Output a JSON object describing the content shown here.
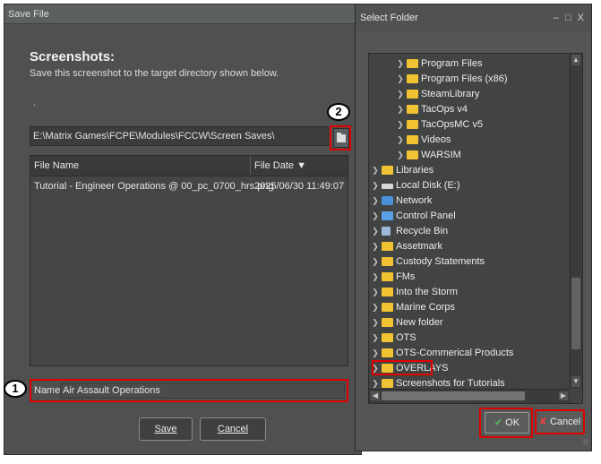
{
  "save_dialog": {
    "title": "Save File",
    "heading": "Screenshots:",
    "subtitle": "Save this screenshot to the target directory shown below.",
    "dot": ".",
    "path": "E:\\Matrix Games\\FCPE\\Modules\\FCCW\\Screen Saves\\",
    "columns": {
      "name": "File Name",
      "date": "File Date ▼"
    },
    "files": [
      {
        "name": "Tutorial - Engineer Operations @ 00_pc_0700_hrs.png",
        "date": "2025/06/30 11:49:07"
      }
    ],
    "name_label": "Name:",
    "name_value": "Air Assault Operations",
    "save_label": "Save",
    "cancel_label": "Cancel"
  },
  "annotations": {
    "badge1": "1",
    "badge2": "2",
    "highlight_color": "#e00000"
  },
  "folder_dialog": {
    "title": "Select Folder",
    "window_controls": "– □ X",
    "tree": [
      {
        "label": "Program Files",
        "icon": "folder-icon"
      },
      {
        "label": "Program Files (x86)",
        "icon": "folder-icon"
      },
      {
        "label": "SteamLibrary",
        "icon": "folder-icon"
      },
      {
        "label": "TacOps v4",
        "icon": "folder-icon"
      },
      {
        "label": "TacOpsMC v5",
        "icon": "folder-icon"
      },
      {
        "label": "Videos",
        "icon": "folder-icon"
      },
      {
        "label": "WARSIM",
        "icon": "folder-icon"
      },
      {
        "label": "Libraries",
        "icon": "folder-icon"
      },
      {
        "label": "Local Disk (E:)",
        "icon": "drive-icon"
      },
      {
        "label": "Network",
        "icon": "network-icon"
      },
      {
        "label": "Control Panel",
        "icon": "control-panel-icon"
      },
      {
        "label": "Recycle Bin",
        "icon": "recycle-bin-icon"
      },
      {
        "label": "Assetmark",
        "icon": "folder-icon"
      },
      {
        "label": "Custody Statements",
        "icon": "folder-icon"
      },
      {
        "label": "FMs",
        "icon": "folder-icon"
      },
      {
        "label": "Into the Storm",
        "icon": "folder-icon"
      },
      {
        "label": "Marine Corps",
        "icon": "folder-icon"
      },
      {
        "label": "New folder",
        "icon": "folder-icon"
      },
      {
        "label": "OTS",
        "icon": "folder-icon"
      },
      {
        "label": "OTS-Commerical Products",
        "icon": "folder-icon"
      },
      {
        "label": "OVERLAYS",
        "icon": "folder-icon"
      },
      {
        "label": "Screenshots for Tutorials",
        "icon": "folder-icon"
      }
    ],
    "ok_label": "OK",
    "cancel_label": "Cancel"
  }
}
